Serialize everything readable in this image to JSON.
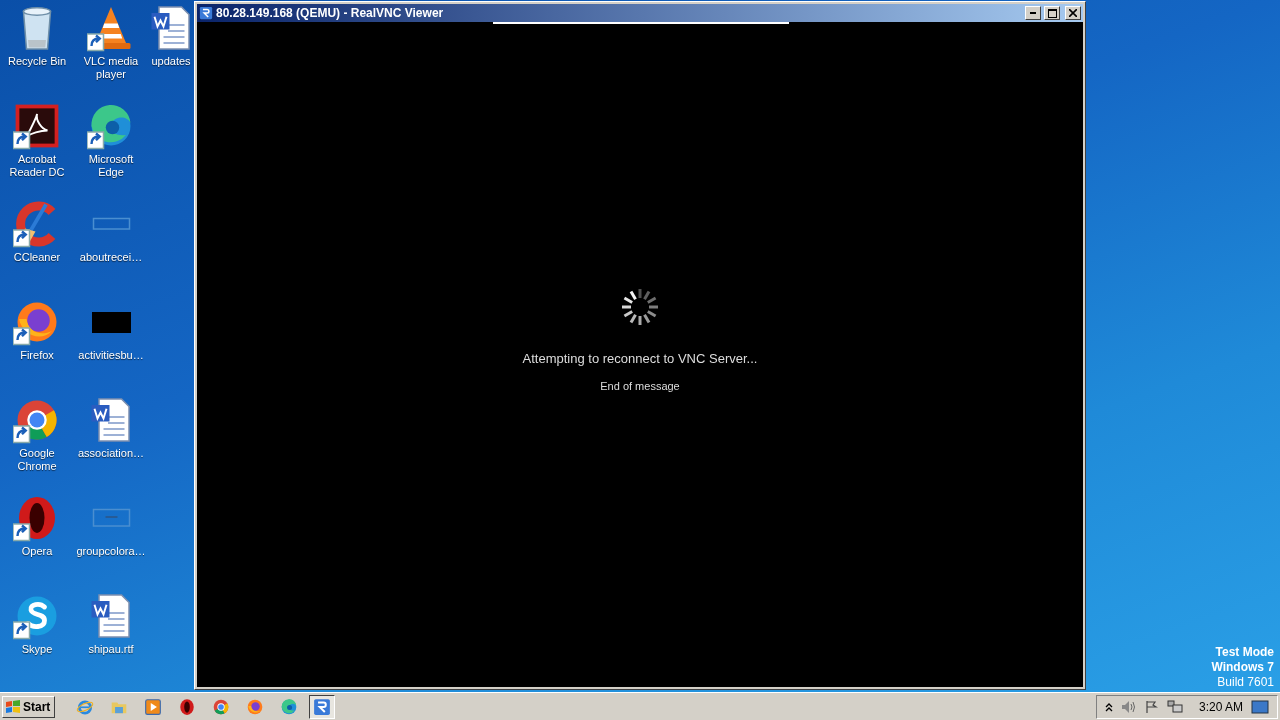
{
  "desktop": {
    "icons": [
      {
        "label": "Recycle Bin",
        "kind": "recycle",
        "shortcut": false
      },
      {
        "label": "Acrobat Reader DC",
        "kind": "acrobat",
        "shortcut": true
      },
      {
        "label": "CCleaner",
        "kind": "ccleaner",
        "shortcut": true
      },
      {
        "label": "Firefox",
        "kind": "firefox",
        "shortcut": true
      },
      {
        "label": "Google Chrome",
        "kind": "chrome",
        "shortcut": true
      },
      {
        "label": "Opera",
        "kind": "opera",
        "shortcut": true
      },
      {
        "label": "Skype",
        "kind": "skype",
        "shortcut": true
      },
      {
        "label": "VLC media player",
        "kind": "vlc",
        "shortcut": true
      },
      {
        "label": "Microsoft Edge",
        "kind": "edge",
        "shortcut": true
      },
      {
        "label": "aboutrecei…",
        "kind": "blank",
        "shortcut": false
      },
      {
        "label": "activitiesbu…",
        "kind": "black",
        "shortcut": false
      },
      {
        "label": "association…",
        "kind": "word",
        "shortcut": false
      },
      {
        "label": "groupcolora…",
        "kind": "dash",
        "shortcut": false
      },
      {
        "label": "shipau.rtf",
        "kind": "word",
        "shortcut": false
      },
      {
        "label": "updates",
        "kind": "word",
        "shortcut": false
      }
    ],
    "system_notice": [
      "Test Mode",
      "Windows 7",
      "Build 7601"
    ]
  },
  "window": {
    "title": "80.28.149.168 (QEMU) - RealVNC Viewer",
    "message": "Attempting to reconnect to VNC Server...",
    "submessage": "End of message"
  },
  "taskbar": {
    "start": "Start",
    "quick_launch": [
      {
        "kind": "ie"
      },
      {
        "kind": "folder"
      },
      {
        "kind": "media"
      },
      {
        "kind": "opera"
      },
      {
        "kind": "chrome"
      },
      {
        "kind": "firefox"
      },
      {
        "kind": "edge"
      }
    ],
    "tasks": [
      {
        "kind": "vnc",
        "selected": true
      }
    ],
    "clock": "3:20 AM"
  }
}
